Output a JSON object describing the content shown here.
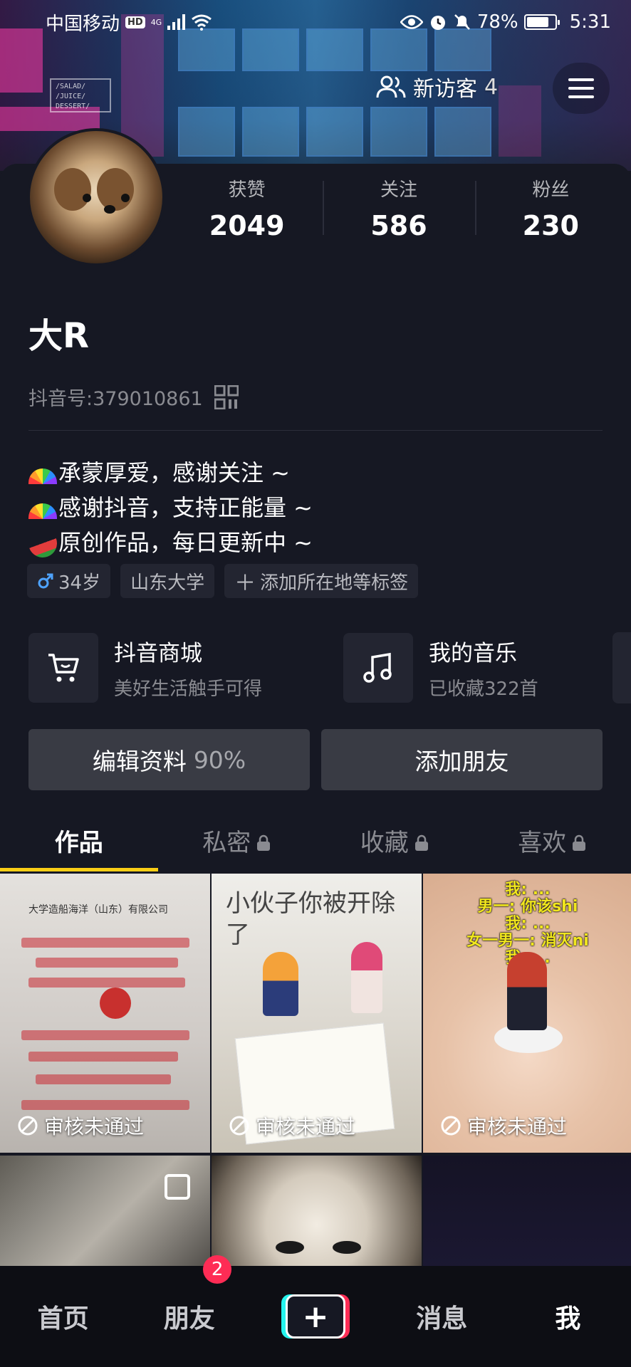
{
  "status_bar": {
    "carrier": "中国移动",
    "hd": "HD",
    "network": "4G",
    "battery": "78%",
    "battery_level": 0.78,
    "time": "5:31"
  },
  "header": {
    "visitors_label": "新访客",
    "visitors_count": "4"
  },
  "profile": {
    "name": "大R",
    "douyin_id_label": "抖音号:",
    "douyin_id": "379010861",
    "stats": [
      {
        "label": "获赞",
        "value": "2049"
      },
      {
        "label": "关注",
        "value": "586"
      },
      {
        "label": "粉丝",
        "value": "230"
      }
    ],
    "bio": [
      "承蒙厚爱，感谢关注 ~",
      "感谢抖音，支持正能量 ~",
      "原创作品，每日更新中 ~"
    ],
    "tags": {
      "gender_age": "34岁",
      "school": "山东大学",
      "add_location": "添加所在地等标签"
    }
  },
  "services": [
    {
      "title": "抖音商城",
      "subtitle": "美好生活触手可得",
      "icon": "cart-icon"
    },
    {
      "title": "我的音乐",
      "subtitle": "已收藏322首",
      "icon": "music-note-icon"
    }
  ],
  "actions": {
    "edit_profile": "编辑资料",
    "edit_percent": "90%",
    "add_friend": "添加朋友"
  },
  "tabs": [
    {
      "label": "作品",
      "locked": false,
      "active": true
    },
    {
      "label": "私密",
      "locked": true,
      "active": false
    },
    {
      "label": "收藏",
      "locked": true,
      "active": false
    },
    {
      "label": "喜欢",
      "locked": true,
      "active": false
    }
  ],
  "videos": {
    "review_failed_label": "审核未通过",
    "video1_header": "大学造船海洋（山东）有限公司",
    "video2_title": "小伙子你被开除了",
    "video3_subtitles": [
      "我: ...",
      "男一: 你该shi",
      "我: ...",
      "女一男一: 消灭ni",
      "我: ..."
    ]
  },
  "bottom_nav": {
    "home": "首页",
    "friends": "朋友",
    "friends_badge": "2",
    "messages": "消息",
    "me": "我",
    "create": "+"
  },
  "colors": {
    "background": "#161823",
    "accent_yellow": "#face15",
    "badge_red": "#fe2c55",
    "cyan": "#25f4ee"
  }
}
